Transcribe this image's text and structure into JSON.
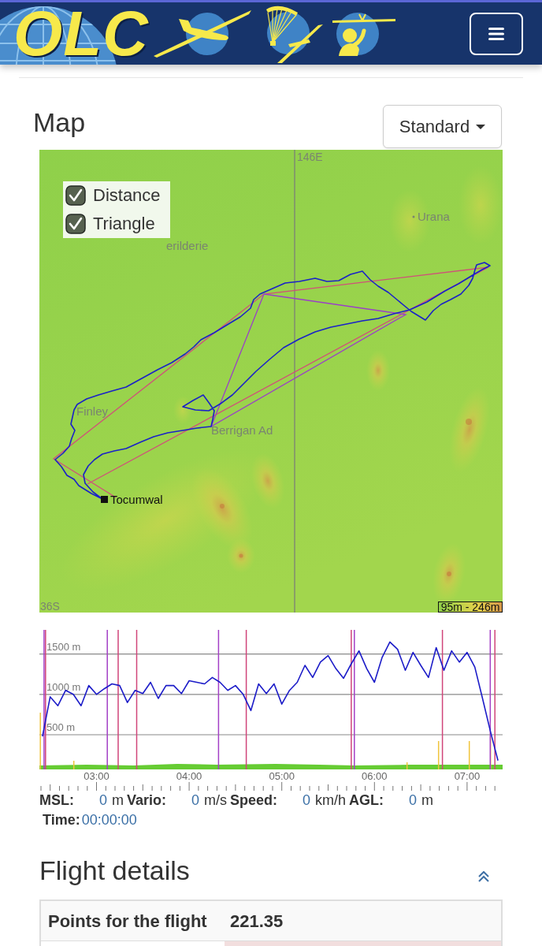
{
  "header": {
    "logo_text": "OLC"
  },
  "map_section": {
    "title": "Map",
    "dropdown": {
      "label": "Standard"
    },
    "legend": [
      {
        "label": "Distance",
        "checked": true
      },
      {
        "label": "Triangle",
        "checked": true
      }
    ],
    "grid_labels": [
      "146E",
      "36S"
    ],
    "places": [
      {
        "name": "Urana",
        "kind": "town"
      },
      {
        "name": "erilderie",
        "kind": "place"
      },
      {
        "name": "Finley",
        "kind": "place"
      },
      {
        "name": "Berrigan Ad",
        "kind": "place"
      },
      {
        "name": "Tocumwal",
        "kind": "airfield"
      }
    ],
    "elevation_scale": "95m - 246m"
  },
  "barogram": {
    "chart_data": {
      "type": "line",
      "x": [
        145,
        150,
        155,
        160,
        165,
        170,
        175,
        180,
        185,
        190,
        195,
        200,
        205,
        210,
        215,
        220,
        225,
        230,
        235,
        240,
        245,
        250,
        255,
        260,
        265,
        270,
        275,
        280,
        285,
        290,
        295,
        300,
        305,
        310,
        315,
        320,
        325,
        330,
        335,
        340,
        345,
        350,
        355,
        360,
        365,
        370,
        375,
        380,
        385,
        390,
        395,
        400,
        405,
        410,
        415,
        420,
        425,
        430,
        435,
        440
      ],
      "series": [
        {
          "color": "#1c1cc8",
          "values": [
            480,
            970,
            860,
            1050,
            1000,
            860,
            1110,
            1000,
            1070,
            1130,
            1110,
            900,
            1050,
            1010,
            1150,
            950,
            1110,
            1110,
            1010,
            1170,
            1150,
            1130,
            1210,
            1150,
            1050,
            1110,
            1000,
            800,
            1130,
            1010,
            1130,
            880,
            1050,
            1150,
            1360,
            1210,
            1400,
            1480,
            1320,
            1200,
            1380,
            1540,
            1320,
            1150,
            1460,
            1650,
            1560,
            1300,
            1520,
            1360,
            1210,
            1580,
            1300,
            1540,
            1400,
            1520,
            1340,
            950,
            550,
            180
          ]
        }
      ],
      "xlim": [
        143,
        443
      ],
      "ylim": [
        70,
        1800
      ],
      "xticks": [
        {
          "value": 180,
          "label": "03:00"
        },
        {
          "value": 240,
          "label": "04:00"
        },
        {
          "value": 300,
          "label": "05:00"
        },
        {
          "value": 360,
          "label": "06:00"
        },
        {
          "value": 420,
          "label": "07:00"
        }
      ],
      "yticks": [
        {
          "value": 500,
          "label": "500 m"
        },
        {
          "value": 1000,
          "label": "1000 m"
        },
        {
          "value": 1500,
          "label": "1500 m"
        }
      ],
      "grid": true,
      "ref_lines": [
        {
          "axis": "x",
          "value": 146,
          "color": "#a33fc6"
        },
        {
          "axis": "x",
          "value": 147,
          "color": "#d0457a"
        },
        {
          "axis": "x",
          "value": 187,
          "color": "#a33fc6"
        },
        {
          "axis": "x",
          "value": 194,
          "color": "#d0457a"
        },
        {
          "axis": "x",
          "value": 206,
          "color": "#d0457a"
        },
        {
          "axis": "x",
          "value": 259,
          "color": "#a33fc6"
        },
        {
          "axis": "x",
          "value": 277,
          "color": "#d0457a"
        },
        {
          "axis": "x",
          "value": 345,
          "color": "#d0457a"
        },
        {
          "axis": "x",
          "value": 347,
          "color": "#a33fc6"
        },
        {
          "axis": "x",
          "value": 404,
          "color": "#d0457a"
        },
        {
          "axis": "x",
          "value": 435,
          "color": "#a33fc6"
        },
        {
          "axis": "x",
          "value": 438,
          "color": "#d0457a"
        }
      ]
    },
    "readout": [
      {
        "label": "MSL:",
        "value": "0",
        "unit": "m"
      },
      {
        "label": "Vario:",
        "value": "0",
        "unit": "m/s"
      },
      {
        "label": "Speed:",
        "value": "0",
        "unit": "km/h"
      },
      {
        "label": "AGL:",
        "value": "0",
        "unit": "m"
      },
      {
        "label": "Time:",
        "value": "00:00:00"
      }
    ]
  },
  "flight_details": {
    "title": "Flight details",
    "expanded": true,
    "rows": [
      {
        "kind": "striped",
        "label": "Points for the flight",
        "value": "221.35"
      },
      {
        "kind": "danger"
      }
    ]
  }
}
